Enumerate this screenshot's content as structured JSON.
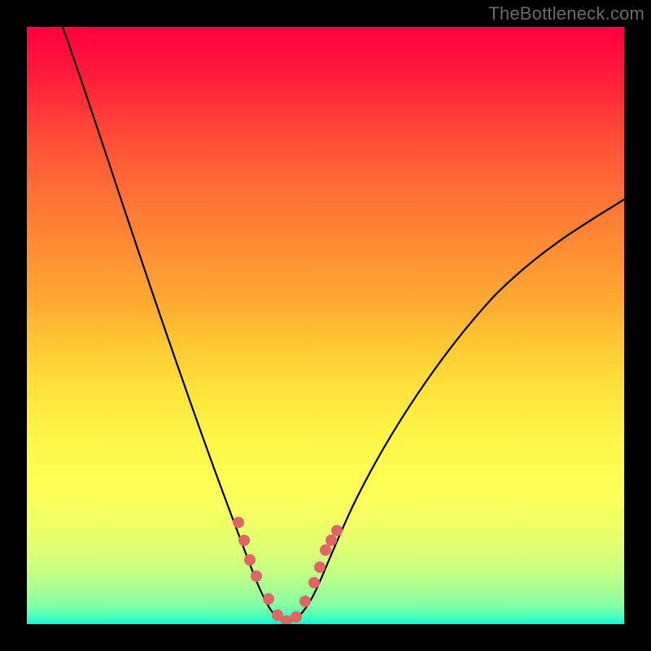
{
  "watermark": "TheBottleneck.com",
  "colors": {
    "background": "#000000",
    "curve": "#000000",
    "marker": "#e06666",
    "gradient_top": "#ff0040",
    "gradient_bottom": "#00ffd6"
  },
  "chart_data": {
    "type": "line",
    "title": "",
    "xlabel": "",
    "ylabel": "",
    "xlim": [
      0,
      100
    ],
    "ylim": [
      0,
      100
    ],
    "series": [
      {
        "name": "bottleneck-curve",
        "x": [
          6,
          10,
          15,
          20,
          25,
          28,
          30,
          32,
          34,
          36,
          38,
          40,
          41,
          42,
          43,
          44,
          45,
          48,
          52,
          56,
          60,
          65,
          70,
          75,
          80,
          85,
          90,
          95,
          100
        ],
        "y": [
          100,
          88,
          74,
          60,
          46,
          38,
          32,
          26,
          20,
          14,
          9,
          5,
          3,
          1,
          0.5,
          1,
          3,
          7,
          13,
          20,
          27,
          36,
          42,
          48,
          53,
          58,
          62,
          66,
          70
        ]
      }
    ],
    "highlight_points": {
      "name": "min-region-markers",
      "x_approx": [
        35.5,
        36.5,
        37.5,
        38.5,
        40.5,
        42,
        43.5,
        45,
        46.5,
        48,
        49,
        50,
        51,
        52
      ],
      "y_approx": [
        17,
        14,
        11,
        8.5,
        4.5,
        1.5,
        0.7,
        1.3,
        4,
        7,
        9.7,
        12.5,
        14.2,
        15.8
      ]
    }
  }
}
